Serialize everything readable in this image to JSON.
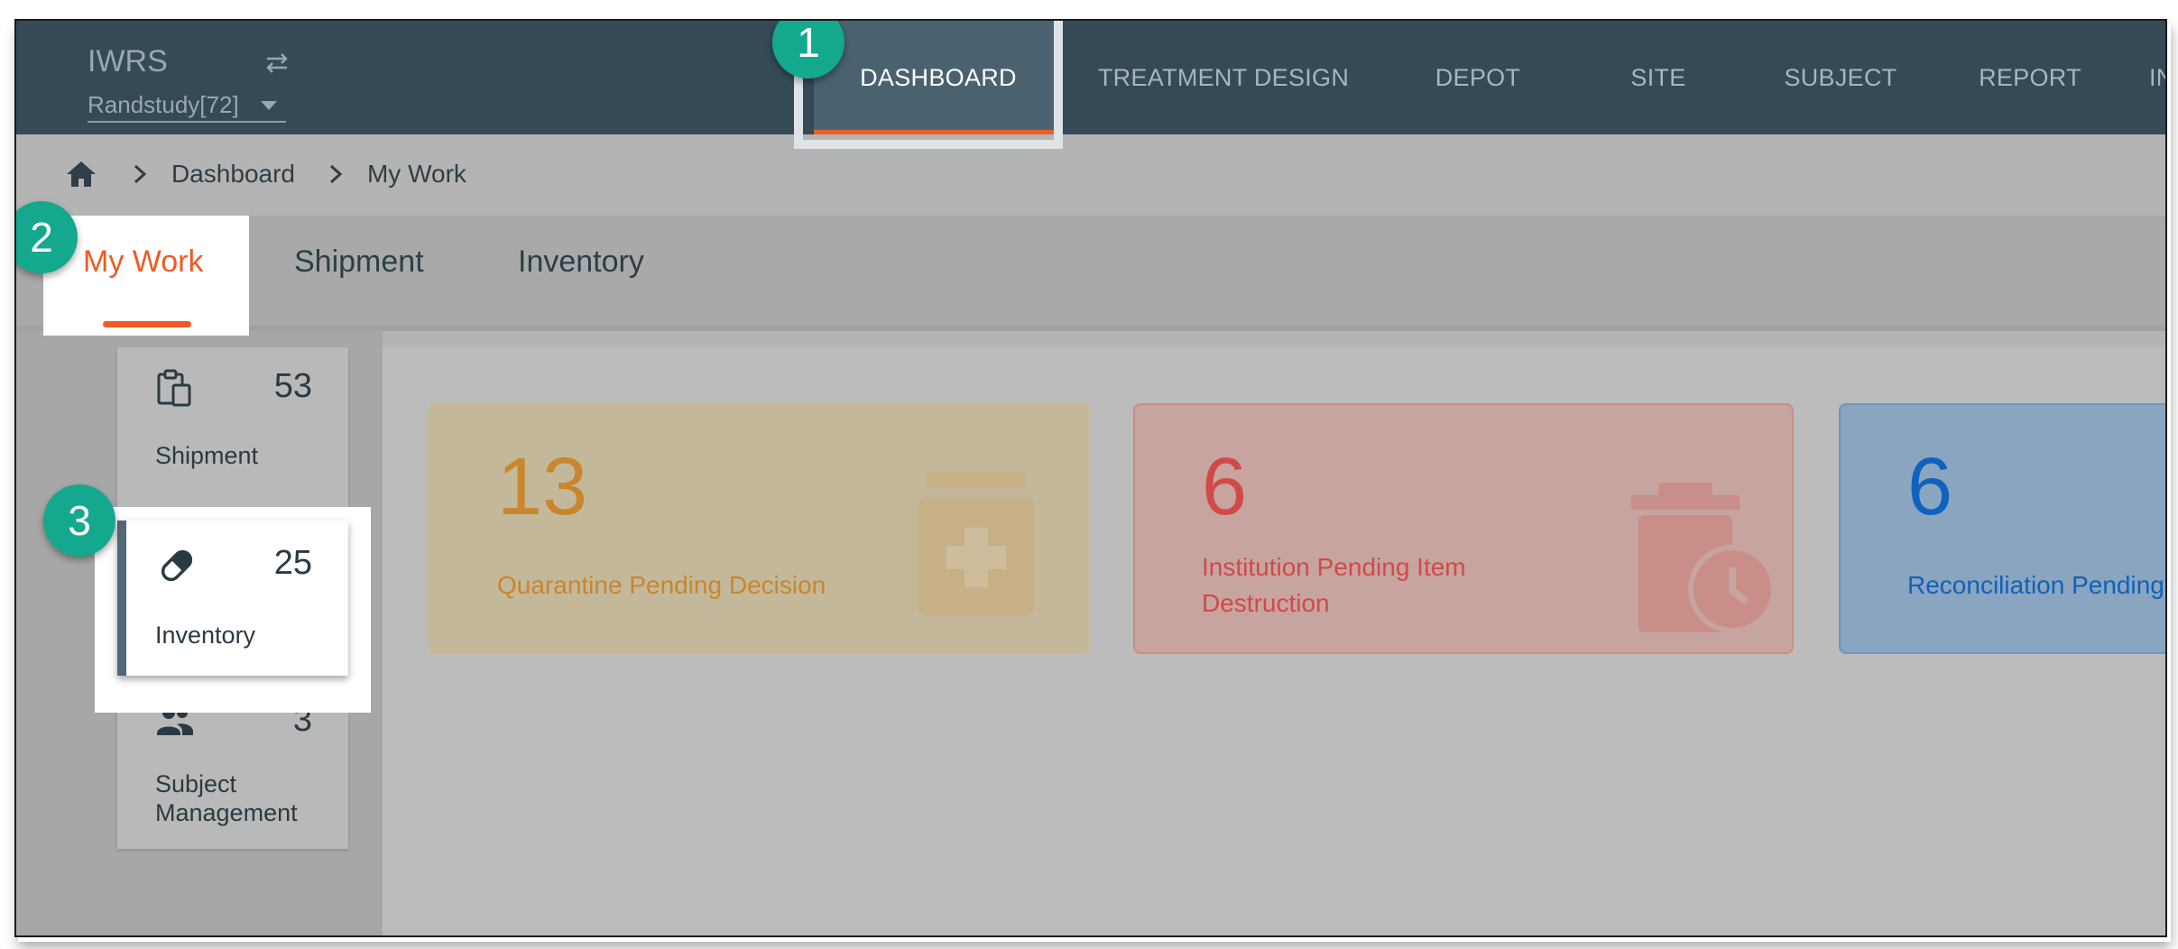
{
  "app": {
    "title": "IWRS",
    "study_selector": "Randstudy[72]"
  },
  "nav": {
    "items": [
      {
        "label": "DASHBOARD",
        "active": true
      },
      {
        "label": "TREATMENT DESIGN"
      },
      {
        "label": "DEPOT"
      },
      {
        "label": "SITE"
      },
      {
        "label": "SUBJECT"
      },
      {
        "label": "REPORT"
      },
      {
        "label": "IN"
      }
    ]
  },
  "breadcrumb": {
    "items": [
      "Dashboard",
      "My Work"
    ]
  },
  "tabs": {
    "items": [
      {
        "label": "My Work",
        "active": true
      },
      {
        "label": "Shipment"
      },
      {
        "label": "Inventory"
      }
    ]
  },
  "side_menu": {
    "items": [
      {
        "label": "Shipment",
        "count": "53",
        "icon": "clipboard-icon"
      },
      {
        "label": "Inventory",
        "count": "25",
        "icon": "pill-icon",
        "selected": true
      },
      {
        "label": "Subject Management",
        "count": "3",
        "icon": "people-icon"
      }
    ]
  },
  "cards": [
    {
      "number": "13",
      "label": "Quarantine Pending Decision",
      "icon": "medicine-jar-icon",
      "color": "#c9862c"
    },
    {
      "number": "6",
      "label_line1": "Institution Pending Item",
      "label_line2": "Destruction",
      "icon": "trash-clock-icon",
      "color": "#d24949"
    },
    {
      "number": "6",
      "label": "Reconciliation Pending",
      "color": "#0e63bd"
    }
  ],
  "steps": [
    "1",
    "2",
    "3"
  ],
  "colors": {
    "topbar": "#344a57",
    "accent": "#ee5b23",
    "step_marker": "#14a98e"
  }
}
